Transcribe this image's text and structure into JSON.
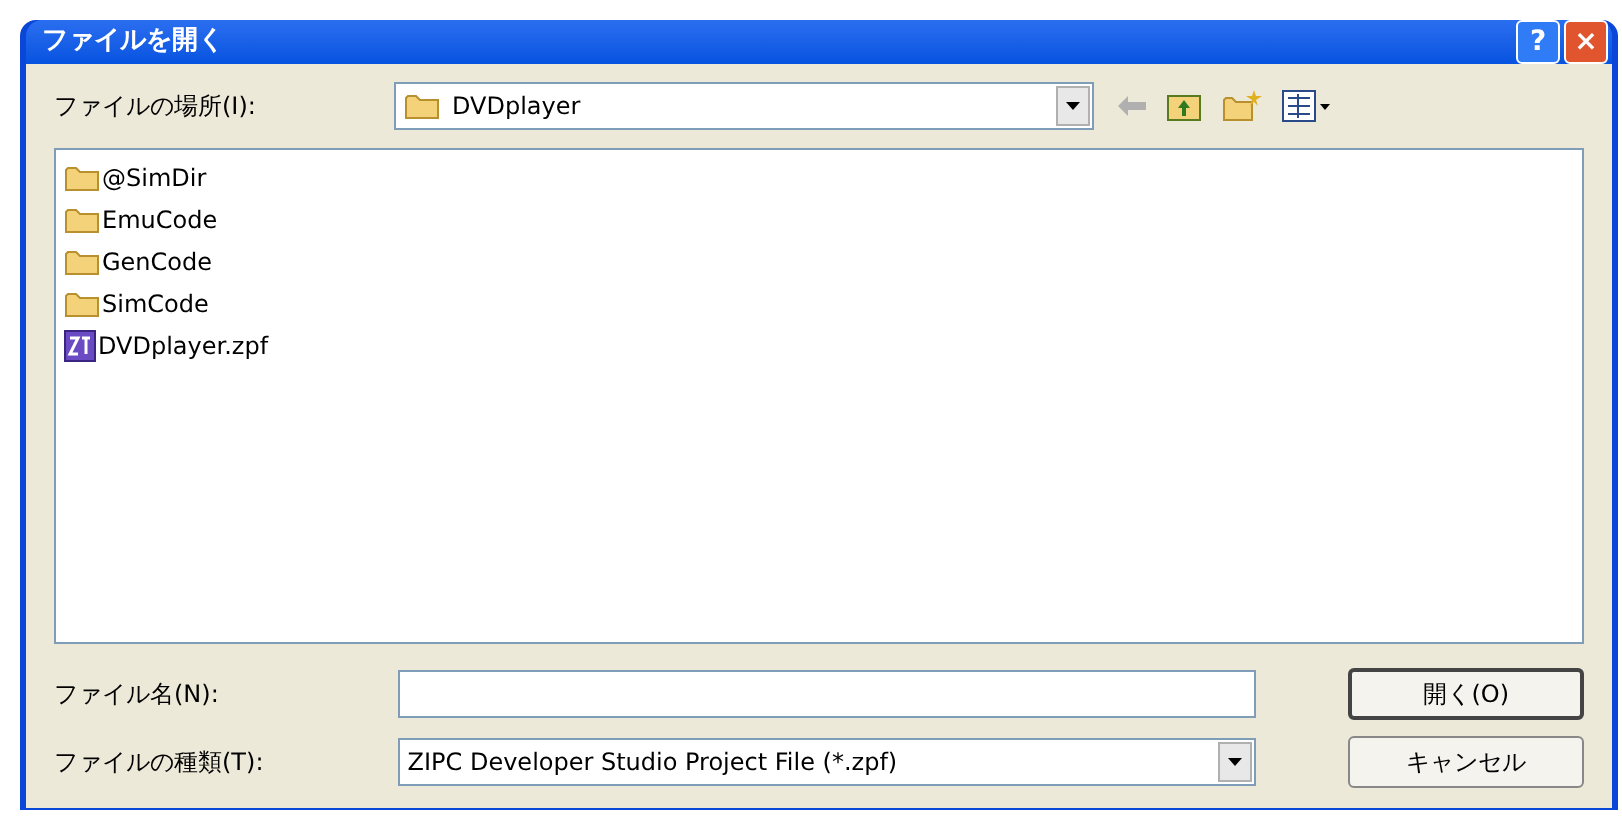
{
  "window": {
    "title": "ファイルを開く"
  },
  "title_buttons": [
    {
      "kind": "help",
      "label": "?"
    },
    {
      "kind": "close",
      "label": "×"
    }
  ],
  "location": {
    "label": "ファイルの場所(I):",
    "value": "DVDplayer"
  },
  "files": [
    {
      "name": "@SimDir",
      "kind": "folder"
    },
    {
      "name": "EmuCode",
      "kind": "folder"
    },
    {
      "name": "GenCode",
      "kind": "folder"
    },
    {
      "name": "SimCode",
      "kind": "folder"
    },
    {
      "name": "DVDplayer.zpf",
      "kind": "project"
    }
  ],
  "file_name": {
    "label": "ファイル名(N):"
  },
  "file_type": {
    "label": "ファイルの種類(T):",
    "value": "ZIPC Developer Studio Project File (*.zpf)"
  },
  "buttons": [
    {
      "label": "開く(O)",
      "default": true
    },
    {
      "label": "キャンセル",
      "default": false
    }
  ]
}
